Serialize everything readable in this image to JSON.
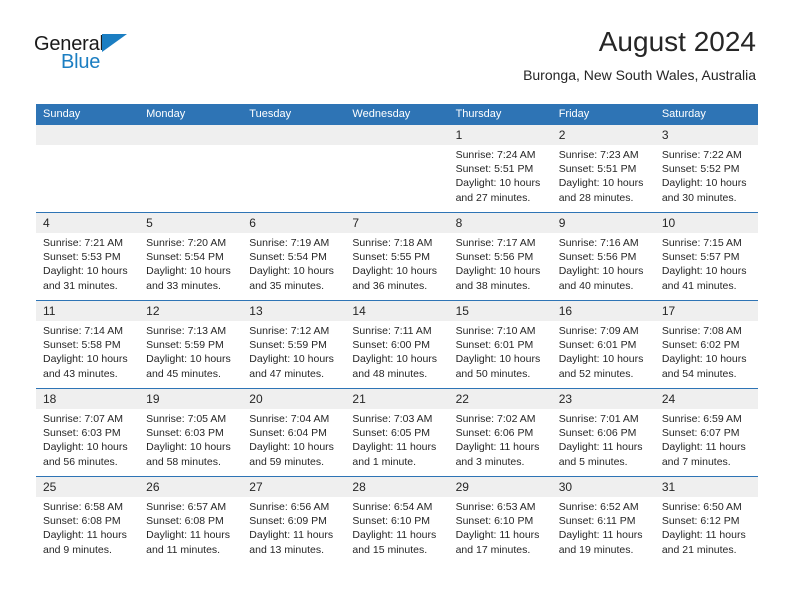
{
  "brand": {
    "name_top": "General",
    "name_bottom": "Blue",
    "triangle_color": "#1b7ec2"
  },
  "header": {
    "title": "August 2024",
    "subtitle": "Buronga, New South Wales, Australia"
  },
  "theme": {
    "header_blue": "#2e74b5",
    "daynum_gray": "#efefef",
    "text": "#262626"
  },
  "weekday_headers": [
    "Sunday",
    "Monday",
    "Tuesday",
    "Wednesday",
    "Thursday",
    "Friday",
    "Saturday"
  ],
  "labels": {
    "sunrise_prefix": "Sunrise:",
    "sunset_prefix": "Sunset:",
    "daylight_prefix": "Daylight:"
  },
  "weeks": [
    [
      {
        "day": "",
        "empty": true
      },
      {
        "day": "",
        "empty": true
      },
      {
        "day": "",
        "empty": true
      },
      {
        "day": "",
        "empty": true
      },
      {
        "day": "1",
        "sunrise": "Sunrise: 7:24 AM",
        "sunset": "Sunset: 5:51 PM",
        "daylight": "Daylight: 10 hours and 27 minutes."
      },
      {
        "day": "2",
        "sunrise": "Sunrise: 7:23 AM",
        "sunset": "Sunset: 5:51 PM",
        "daylight": "Daylight: 10 hours and 28 minutes."
      },
      {
        "day": "3",
        "sunrise": "Sunrise: 7:22 AM",
        "sunset": "Sunset: 5:52 PM",
        "daylight": "Daylight: 10 hours and 30 minutes."
      }
    ],
    [
      {
        "day": "4",
        "sunrise": "Sunrise: 7:21 AM",
        "sunset": "Sunset: 5:53 PM",
        "daylight": "Daylight: 10 hours and 31 minutes."
      },
      {
        "day": "5",
        "sunrise": "Sunrise: 7:20 AM",
        "sunset": "Sunset: 5:54 PM",
        "daylight": "Daylight: 10 hours and 33 minutes."
      },
      {
        "day": "6",
        "sunrise": "Sunrise: 7:19 AM",
        "sunset": "Sunset: 5:54 PM",
        "daylight": "Daylight: 10 hours and 35 minutes."
      },
      {
        "day": "7",
        "sunrise": "Sunrise: 7:18 AM",
        "sunset": "Sunset: 5:55 PM",
        "daylight": "Daylight: 10 hours and 36 minutes."
      },
      {
        "day": "8",
        "sunrise": "Sunrise: 7:17 AM",
        "sunset": "Sunset: 5:56 PM",
        "daylight": "Daylight: 10 hours and 38 minutes."
      },
      {
        "day": "9",
        "sunrise": "Sunrise: 7:16 AM",
        "sunset": "Sunset: 5:56 PM",
        "daylight": "Daylight: 10 hours and 40 minutes."
      },
      {
        "day": "10",
        "sunrise": "Sunrise: 7:15 AM",
        "sunset": "Sunset: 5:57 PM",
        "daylight": "Daylight: 10 hours and 41 minutes."
      }
    ],
    [
      {
        "day": "11",
        "sunrise": "Sunrise: 7:14 AM",
        "sunset": "Sunset: 5:58 PM",
        "daylight": "Daylight: 10 hours and 43 minutes."
      },
      {
        "day": "12",
        "sunrise": "Sunrise: 7:13 AM",
        "sunset": "Sunset: 5:59 PM",
        "daylight": "Daylight: 10 hours and 45 minutes."
      },
      {
        "day": "13",
        "sunrise": "Sunrise: 7:12 AM",
        "sunset": "Sunset: 5:59 PM",
        "daylight": "Daylight: 10 hours and 47 minutes."
      },
      {
        "day": "14",
        "sunrise": "Sunrise: 7:11 AM",
        "sunset": "Sunset: 6:00 PM",
        "daylight": "Daylight: 10 hours and 48 minutes."
      },
      {
        "day": "15",
        "sunrise": "Sunrise: 7:10 AM",
        "sunset": "Sunset: 6:01 PM",
        "daylight": "Daylight: 10 hours and 50 minutes."
      },
      {
        "day": "16",
        "sunrise": "Sunrise: 7:09 AM",
        "sunset": "Sunset: 6:01 PM",
        "daylight": "Daylight: 10 hours and 52 minutes."
      },
      {
        "day": "17",
        "sunrise": "Sunrise: 7:08 AM",
        "sunset": "Sunset: 6:02 PM",
        "daylight": "Daylight: 10 hours and 54 minutes."
      }
    ],
    [
      {
        "day": "18",
        "sunrise": "Sunrise: 7:07 AM",
        "sunset": "Sunset: 6:03 PM",
        "daylight": "Daylight: 10 hours and 56 minutes."
      },
      {
        "day": "19",
        "sunrise": "Sunrise: 7:05 AM",
        "sunset": "Sunset: 6:03 PM",
        "daylight": "Daylight: 10 hours and 58 minutes."
      },
      {
        "day": "20",
        "sunrise": "Sunrise: 7:04 AM",
        "sunset": "Sunset: 6:04 PM",
        "daylight": "Daylight: 10 hours and 59 minutes."
      },
      {
        "day": "21",
        "sunrise": "Sunrise: 7:03 AM",
        "sunset": "Sunset: 6:05 PM",
        "daylight": "Daylight: 11 hours and 1 minute."
      },
      {
        "day": "22",
        "sunrise": "Sunrise: 7:02 AM",
        "sunset": "Sunset: 6:06 PM",
        "daylight": "Daylight: 11 hours and 3 minutes."
      },
      {
        "day": "23",
        "sunrise": "Sunrise: 7:01 AM",
        "sunset": "Sunset: 6:06 PM",
        "daylight": "Daylight: 11 hours and 5 minutes."
      },
      {
        "day": "24",
        "sunrise": "Sunrise: 6:59 AM",
        "sunset": "Sunset: 6:07 PM",
        "daylight": "Daylight: 11 hours and 7 minutes."
      }
    ],
    [
      {
        "day": "25",
        "sunrise": "Sunrise: 6:58 AM",
        "sunset": "Sunset: 6:08 PM",
        "daylight": "Daylight: 11 hours and 9 minutes."
      },
      {
        "day": "26",
        "sunrise": "Sunrise: 6:57 AM",
        "sunset": "Sunset: 6:08 PM",
        "daylight": "Daylight: 11 hours and 11 minutes."
      },
      {
        "day": "27",
        "sunrise": "Sunrise: 6:56 AM",
        "sunset": "Sunset: 6:09 PM",
        "daylight": "Daylight: 11 hours and 13 minutes."
      },
      {
        "day": "28",
        "sunrise": "Sunrise: 6:54 AM",
        "sunset": "Sunset: 6:10 PM",
        "daylight": "Daylight: 11 hours and 15 minutes."
      },
      {
        "day": "29",
        "sunrise": "Sunrise: 6:53 AM",
        "sunset": "Sunset: 6:10 PM",
        "daylight": "Daylight: 11 hours and 17 minutes."
      },
      {
        "day": "30",
        "sunrise": "Sunrise: 6:52 AM",
        "sunset": "Sunset: 6:11 PM",
        "daylight": "Daylight: 11 hours and 19 minutes."
      },
      {
        "day": "31",
        "sunrise": "Sunrise: 6:50 AM",
        "sunset": "Sunset: 6:12 PM",
        "daylight": "Daylight: 11 hours and 21 minutes."
      }
    ]
  ]
}
